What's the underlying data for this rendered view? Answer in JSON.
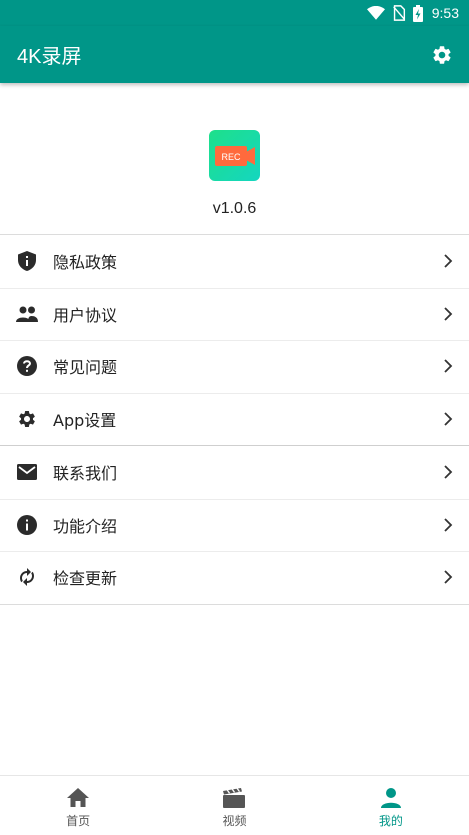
{
  "status_bar": {
    "time": "9:53"
  },
  "app_bar": {
    "title": "4K录屏"
  },
  "header": {
    "version": "v1.0.6",
    "logo_text": "REC"
  },
  "menu": {
    "items": [
      {
        "label": "隐私政策",
        "icon": "shield-icon"
      },
      {
        "label": "用户协议",
        "icon": "people-icon"
      },
      {
        "label": "常见问题",
        "icon": "help-icon"
      },
      {
        "label": "App设置",
        "icon": "gear-icon"
      },
      {
        "label": "联系我们",
        "icon": "mail-icon"
      },
      {
        "label": "功能介绍",
        "icon": "info-icon"
      },
      {
        "label": "检查更新",
        "icon": "sync-icon"
      }
    ]
  },
  "bottom_nav": {
    "items": [
      {
        "label": "首页",
        "icon": "home-icon"
      },
      {
        "label": "视频",
        "icon": "clapper-icon"
      },
      {
        "label": "我的",
        "icon": "person-icon"
      }
    ],
    "active_index": 2
  },
  "colors": {
    "primary": "#009688",
    "logo_green": "#1ee08a",
    "logo_badge": "#ff6a3d"
  }
}
